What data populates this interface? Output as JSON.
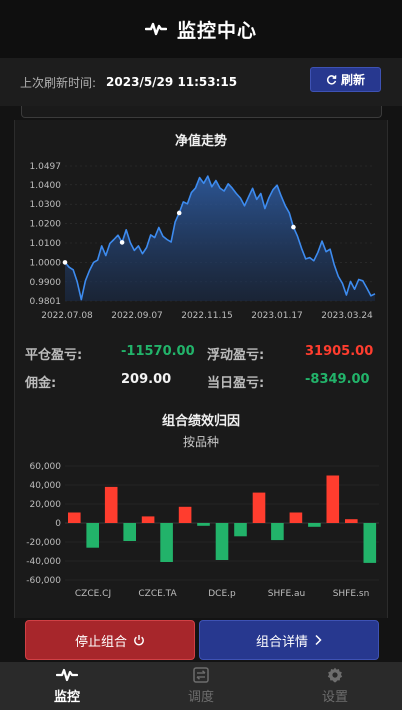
{
  "header": {
    "title": "监控中心",
    "icon": "pulse-icon"
  },
  "refresh": {
    "label": "上次刷新时间:",
    "timestamp": "2023/5/29 11:53:15",
    "button_label": "刷新",
    "button_icon": "refresh-icon"
  },
  "nav_section": {
    "title": "净值走势"
  },
  "stats": {
    "closed_pnl_label": "平仓盈亏:",
    "closed_pnl_value": "-11570.00",
    "floating_pnl_label": "浮动盈亏:",
    "floating_pnl_value": "31905.00",
    "commission_label": "佣金:",
    "commission_value": "209.00",
    "daily_pnl_label": "当日盈亏:",
    "daily_pnl_value": "-8349.00"
  },
  "attribution_section": {
    "title": "组合绩效归因",
    "subtitle": "按品种"
  },
  "buttons": {
    "stop_label": "停止组合",
    "stop_icon": "power-icon",
    "detail_label": "组合详情",
    "detail_icon": "chevron-right-icon"
  },
  "tabs": [
    {
      "label": "监控",
      "icon": "pulse-icon",
      "active": true
    },
    {
      "label": "调度",
      "icon": "schedule-icon",
      "active": false
    },
    {
      "label": "设置",
      "icon": "gear-icon",
      "active": false
    }
  ],
  "colors": {
    "positive": "#22b36a",
    "negative": "#ff3d2e",
    "accent": "#27388f",
    "danger": "#a7262b",
    "line": "#3d8bef"
  },
  "chart_data": [
    {
      "type": "area",
      "title": "净值走势",
      "x_tick_labels": [
        "2022.07.08",
        "2022.09.07",
        "2022.11.15",
        "2023.01.17",
        "2023.03.24"
      ],
      "y_tick_labels": [
        "1.0497",
        "1.0400",
        "1.0300",
        "1.0200",
        "1.0100",
        "1.0000",
        "0.9900",
        "0.9801"
      ],
      "ylim": [
        0.9801,
        1.0497
      ],
      "series": [
        {
          "values": [
            1.0,
            0.9975,
            0.9962,
            0.99,
            0.9808,
            0.9905,
            0.9958,
            1.0,
            1.0012,
            1.0085,
            1.0035,
            1.0098,
            1.0118,
            1.014,
            1.0103,
            1.0168,
            1.0102,
            1.0062,
            1.0085,
            1.0045,
            1.0077,
            1.0142,
            1.0128,
            1.018,
            1.0135,
            1.0118,
            1.0105,
            1.0208,
            1.0255,
            1.0312,
            1.0302,
            1.036,
            1.0383,
            1.0437,
            1.0408,
            1.0445,
            1.039,
            1.0422,
            1.0383,
            1.0368,
            1.0405,
            1.0383,
            1.0355,
            1.0332,
            1.0292,
            1.0338,
            1.0382,
            1.0325,
            1.0355,
            1.0278,
            1.0333,
            1.0375,
            1.0398,
            1.0342,
            1.0292,
            1.0255,
            1.0182,
            1.0135,
            1.0072,
            1.0018,
            1.0025,
            1.0008,
            1.0052,
            1.011,
            1.0055,
            1.0068,
            0.9988,
            0.9928,
            0.9892,
            0.9832,
            0.9902,
            0.9862,
            0.9912,
            0.9905,
            0.9868,
            0.9828,
            0.9838
          ]
        }
      ],
      "marked_points": [
        0,
        14,
        28,
        56
      ]
    },
    {
      "type": "bar",
      "title": "组合绩效归因",
      "subtitle": "按品种",
      "x_tick_labels": [
        "CZCE.CJ",
        "CZCE.TA",
        "DCE.p",
        "SHFE.au",
        "SHFE.sn"
      ],
      "y_tick_labels": [
        "60,000",
        "40,000",
        "20,000",
        "0",
        "-20,000",
        "-40,000",
        "-60,000"
      ],
      "ylim": [
        -60000,
        60000
      ],
      "values": [
        11000,
        -26000,
        38000,
        -19000,
        7000,
        -41000,
        17000,
        -3000,
        -39000,
        -14000,
        32000,
        -18000,
        11000,
        -4000,
        50000,
        4000,
        -42000
      ]
    }
  ]
}
